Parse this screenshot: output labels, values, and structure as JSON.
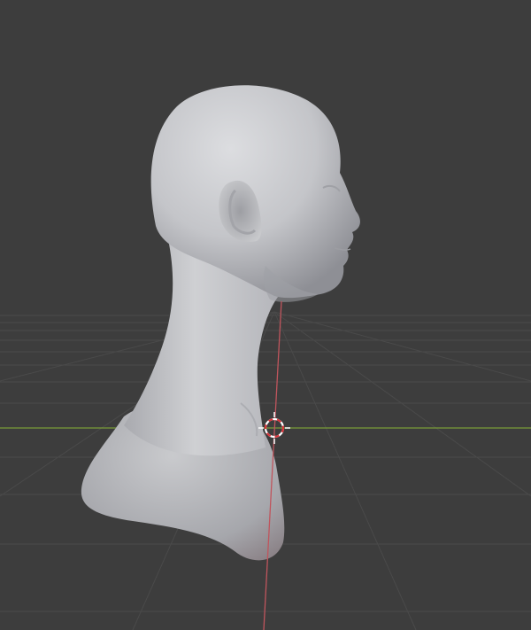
{
  "viewport": {
    "mode": "3d-viewport",
    "shading": "solid",
    "background_color": "#3d3d3d",
    "grid_color": "#4a4a4a",
    "x_axis_color": "#c0555d",
    "y_axis_color": "#7a9c3a",
    "mesh_color": "#c9cacd",
    "cursor_colors": [
      "#d8333a",
      "#ffffff"
    ]
  },
  "scene": {
    "object": {
      "type": "mesh",
      "shape": "sculpted-head-bust",
      "selected": false
    }
  }
}
